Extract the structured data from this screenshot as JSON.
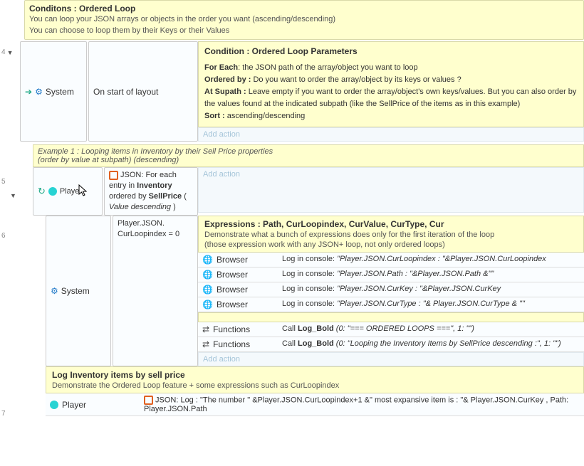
{
  "topInfo": {
    "title": "Conditons : Ordered Loop",
    "line1": "You can loop your JSON arrays or objects in the order you want (ascending/descending)",
    "line2": "You can choose to loop them by their Keys or their Values"
  },
  "gutter": {
    "n4": "4",
    "n5": "5",
    "n6": "6",
    "n7": "7"
  },
  "event4": {
    "system": "System",
    "trigger": "On start of layout",
    "paramTitle": "Condition : Ordered Loop Parameters",
    "p1a": "For Each",
    "p1b": ": the JSON path of the array/object you want to loop",
    "p2a": "Ordered by :",
    "p2b": " Do you want to order the array/object by its keys or values ?",
    "p3a": "At Supath :",
    "p3b": " Leave empty if you want to order the array/object's own keys/values. But you can also order by the values found at the indicated subpath (like the SellPrice of the items as in this example)",
    "p4a": "Sort :",
    "p4b": " ascending/descending",
    "addAction": "Add action"
  },
  "example1": {
    "line1": "Example 1 : Looping items in Inventory by their Sell Price properties",
    "line2": "(order by value at subpath) (descending)"
  },
  "event5": {
    "player": "Player",
    "cond1": "JSON: For each entry in ",
    "cond1b": "Inventory",
    "cond2a": "ordered by ",
    "cond2b": "SellPrice",
    "cond2c": " ( ",
    "cond3": "Value descending",
    "cond3b": " )",
    "addAction": "Add action"
  },
  "event6": {
    "system": "System",
    "cond": "Player.JSON.\nCurLoopindex = 0",
    "condA": "Player.JSON.",
    "condB": "CurLoopindex = 0",
    "exprTitle": "Expressions : Path, CurLoopindex, CurValue, CurType, Cur",
    "exprSub1": "Demonstrate what a bunch of expressions does only for the first iteration of the loop",
    "exprSub2": "(those expression work with any JSON+ loop, not only ordered loops)",
    "browser": "Browser",
    "log1a": "Log in console: ",
    "log1b": "\"Player.JSON.CurLoopindex : \"&Player.JSON.CurLoopindex",
    "log2b": "\"Player.JSON.Path : \"&Player.JSON.Path &\"\"",
    "log3b": "\"Player.JSON.CurKey : \"&Player.JSON.CurKey",
    "log4b": "\"Player.JSON.CurType : \"& Player.JSON.CurType & \"\"",
    "functions": "Functions",
    "call": "Call ",
    "logbold": "Log_Bold",
    "f1": " (0: \"=== ORDERED LOOPS ===\", 1: \"\")",
    "f2": " (0: \"Looping the Inventory Items by SellPrice descending :\", 1: \"\")",
    "addAction": "Add action"
  },
  "event7": {
    "title": "Log Inventory items by sell price",
    "sub": "Demonstrate the Ordered Loop feature + some expressions such as CurLoopindex",
    "player": "Player",
    "actA": "JSON: Log : \"The number \" &Player.JSON.CurLoopindex+1 &\" most expansive item is : \"& Player.JSON.CurKey , Path: Player.JSON.Path"
  }
}
